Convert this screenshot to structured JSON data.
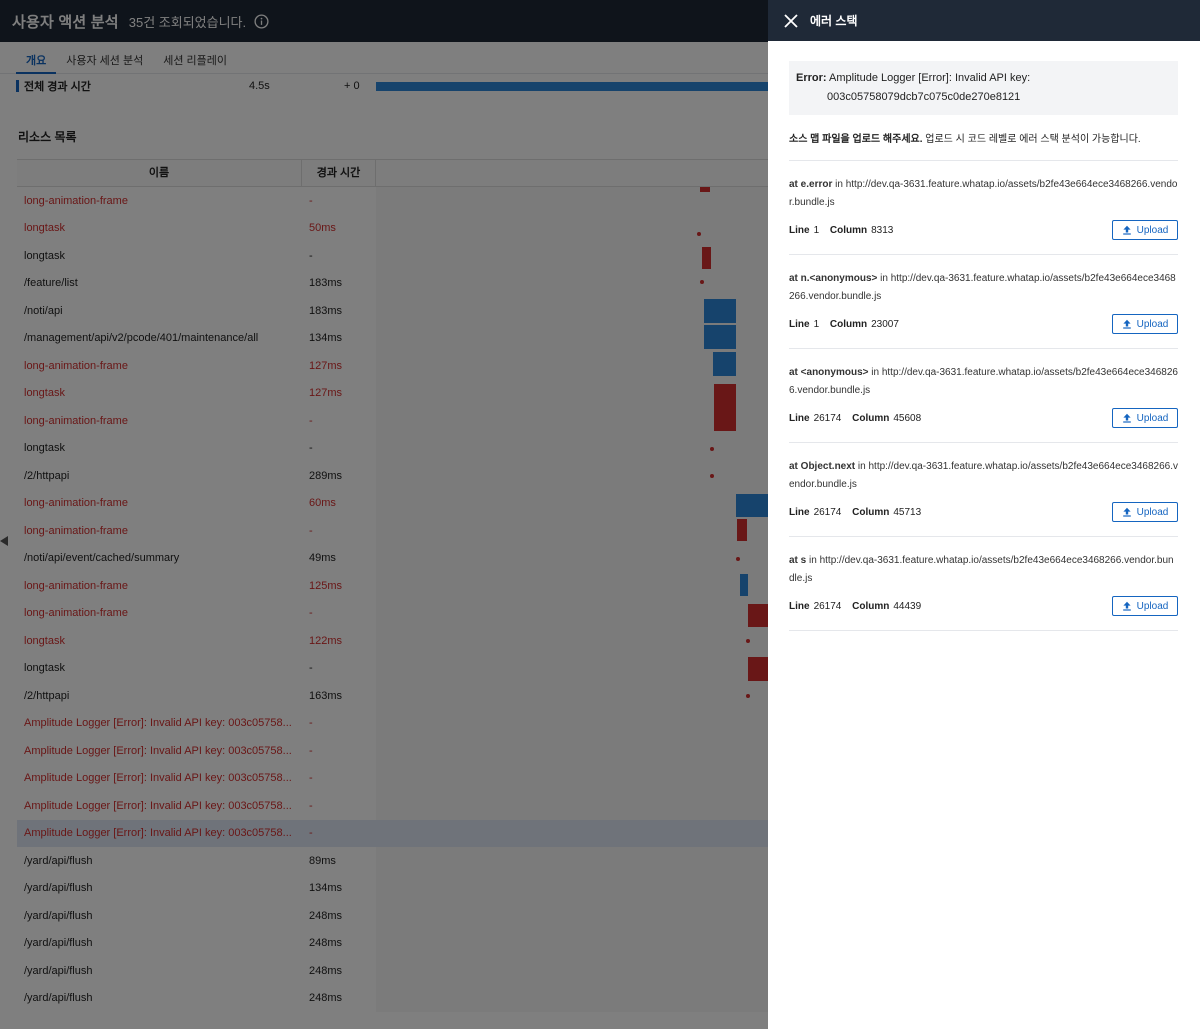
{
  "header": {
    "title": "사용자 액션 분석",
    "count_text": "35건 조회되었습니다.",
    "info_icon": "info-icon"
  },
  "tabs": [
    {
      "label": "개요",
      "active": true
    },
    {
      "label": "사용자 세션 분석",
      "active": false
    },
    {
      "label": "세션 리플레이",
      "active": false
    }
  ],
  "summary": {
    "label": "전체 경과 시간",
    "duration": "4.5s",
    "offset": "+ 0"
  },
  "resources": {
    "title": "리소스 목록",
    "columns": [
      "이름",
      "경과 시간"
    ],
    "rows": [
      {
        "name": "long-animation-frame",
        "duration": "-",
        "error": true
      },
      {
        "name": "longtask",
        "duration": "50ms",
        "error": true
      },
      {
        "name": "longtask",
        "duration": "-",
        "error": false
      },
      {
        "name": "/feature/list",
        "duration": "183ms",
        "error": false
      },
      {
        "name": "/noti/api",
        "duration": "183ms",
        "error": false
      },
      {
        "name": "/management/api/v2/pcode/401/maintenance/all",
        "duration": "134ms",
        "error": false
      },
      {
        "name": "long-animation-frame",
        "duration": "127ms",
        "error": true
      },
      {
        "name": "longtask",
        "duration": "127ms",
        "error": true
      },
      {
        "name": "long-animation-frame",
        "duration": "-",
        "error": true
      },
      {
        "name": "longtask",
        "duration": "-",
        "error": false
      },
      {
        "name": "/2/httpapi",
        "duration": "289ms",
        "error": false
      },
      {
        "name": "long-animation-frame",
        "duration": "60ms",
        "error": true
      },
      {
        "name": "long-animation-frame",
        "duration": "-",
        "error": true
      },
      {
        "name": "/noti/api/event/cached/summary",
        "duration": "49ms",
        "error": false
      },
      {
        "name": "long-animation-frame",
        "duration": "125ms",
        "error": true
      },
      {
        "name": "long-animation-frame",
        "duration": "-",
        "error": true
      },
      {
        "name": "longtask",
        "duration": "122ms",
        "error": true
      },
      {
        "name": "longtask",
        "duration": "-",
        "error": false
      },
      {
        "name": "/2/httpapi",
        "duration": "163ms",
        "error": false
      },
      {
        "name": "Amplitude Logger [Error]: Invalid API key: 003c05758...",
        "duration": "-",
        "error": true
      },
      {
        "name": "Amplitude Logger [Error]: Invalid API key: 003c05758...",
        "duration": "-",
        "error": true
      },
      {
        "name": "Amplitude Logger [Error]: Invalid API key: 003c05758...",
        "duration": "-",
        "error": true
      },
      {
        "name": "Amplitude Logger [Error]: Invalid API key: 003c05758...",
        "duration": "-",
        "error": true
      },
      {
        "name": "Amplitude Logger [Error]: Invalid API key: 003c05758...",
        "duration": "-",
        "error": true,
        "selected": true
      },
      {
        "name": "/yard/api/flush",
        "duration": "89ms",
        "error": false
      },
      {
        "name": "/yard/api/flush",
        "duration": "134ms",
        "error": false
      },
      {
        "name": "/yard/api/flush",
        "duration": "248ms",
        "error": false
      },
      {
        "name": "/yard/api/flush",
        "duration": "248ms",
        "error": false
      },
      {
        "name": "/yard/api/flush",
        "duration": "248ms",
        "error": false
      },
      {
        "name": "/yard/api/flush",
        "duration": "248ms",
        "error": false
      }
    ]
  },
  "panel": {
    "title": "에러 스택",
    "close_icon": "close-icon",
    "error_label": "Error:",
    "error_message_line1": "Amplitude Logger [Error]: Invalid API key:",
    "error_message_line2": "003c05758079dcb7c075c0de270e8121",
    "hint_bold": "소스 맵 파일을 업로드 해주세요.",
    "hint_text": "업로드 시 코드 레벨로 에러 스택 분석이 가능합니다.",
    "line_label": "Line",
    "column_label": "Column",
    "upload_label": "Upload",
    "upload_icon": "upload-icon",
    "frames": [
      {
        "at": "at e.error",
        "in": "in",
        "url": "http://dev.qa-3631.feature.whatap.io/assets/b2fe43e664ece3468266.vendor.bundle.js",
        "line": "1",
        "column": "8313"
      },
      {
        "at": "at n.<anonymous>",
        "in": "in",
        "url": "http://dev.qa-3631.feature.whatap.io/assets/b2fe43e664ece3468266.vendor.bundle.js",
        "line": "1",
        "column": "23007"
      },
      {
        "at": "at <anonymous>",
        "in": "in",
        "url": "http://dev.qa-3631.feature.whatap.io/assets/b2fe43e664ece3468266.vendor.bundle.js",
        "line": "26174",
        "column": "45608"
      },
      {
        "at": "at Object.next",
        "in": "in",
        "url": "http://dev.qa-3631.feature.whatap.io/assets/b2fe43e664ece3468266.vendor.bundle.js",
        "line": "26174",
        "column": "45713"
      },
      {
        "at": "at s",
        "in": "in",
        "url": "http://dev.qa-3631.feature.whatap.io/assets/b2fe43e664ece3468266.vendor.bundle.js",
        "line": "26174",
        "column": "44439"
      }
    ]
  },
  "colors": {
    "accent": "#1565c0",
    "error": "#d32f2f",
    "bar_blue": "#2c86d8",
    "header_bg": "#1f2937"
  }
}
